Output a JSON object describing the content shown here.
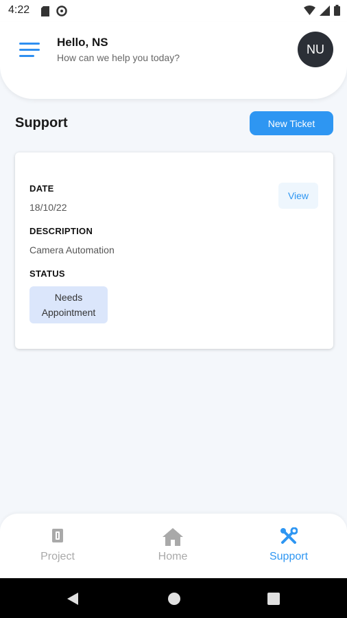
{
  "status_bar": {
    "time": "4:22"
  },
  "header": {
    "greeting": "Hello, NS",
    "subtitle": "How can we help you today?",
    "avatar_initials": "NU"
  },
  "section": {
    "title": "Support",
    "new_ticket_label": "New Ticket"
  },
  "ticket": {
    "date_label": "DATE",
    "date_value": "18/10/22",
    "description_label": "DESCRIPTION",
    "description_value": "Camera Automation",
    "status_label": "STATUS",
    "status_line1": "Needs",
    "status_line2": "Appointment",
    "view_label": "View"
  },
  "bottom_nav": {
    "items": [
      {
        "label": "Project",
        "icon": "project-icon",
        "active": false
      },
      {
        "label": "Home",
        "icon": "home-icon",
        "active": false
      },
      {
        "label": "Support",
        "icon": "support-tools-icon",
        "active": true
      }
    ]
  },
  "colors": {
    "accent": "#2e96f2",
    "inactive": "#a9a9a9",
    "background": "#f4f7fb",
    "status_badge": "#dbe6fb",
    "avatar": "#2b2f36"
  }
}
